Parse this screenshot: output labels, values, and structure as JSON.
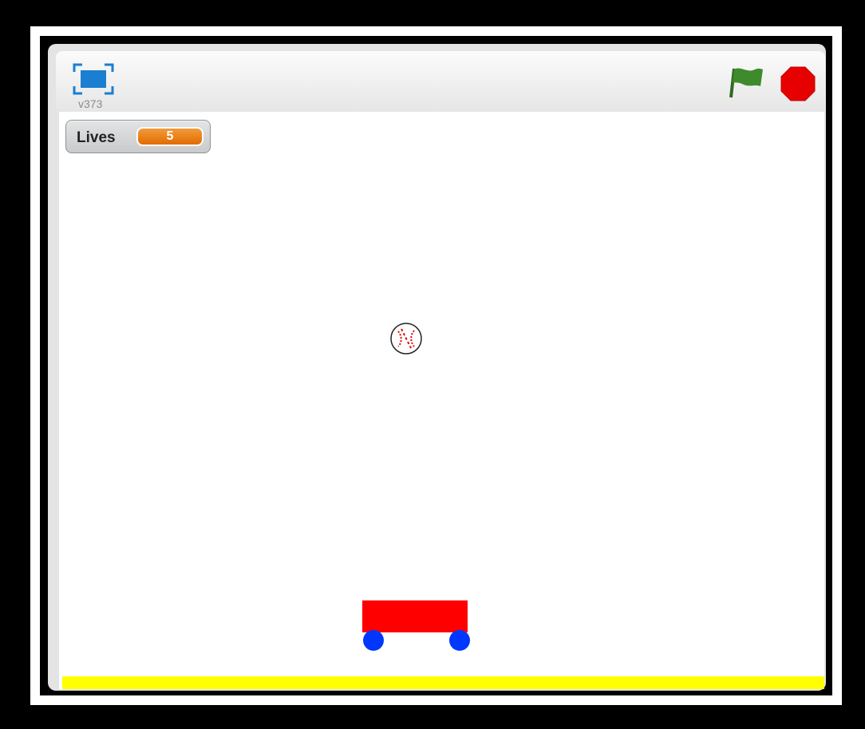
{
  "stage_header": {
    "version": "v373",
    "fullscreen_icon": "fullscreen-icon",
    "flag_icon": "green-flag-icon",
    "stop_icon": "stop-sign-icon"
  },
  "monitor": {
    "label": "Lives",
    "value": "5"
  },
  "colors": {
    "header_accent": "#1a7fd0",
    "flag": "#3f8a2c",
    "stop": "#e60000",
    "monitor_value_bg": "#e97a10",
    "cart_body": "#ff0000",
    "cart_wheels": "#0037ff",
    "ground": "#ffff00"
  },
  "sprites": [
    "baseball",
    "cart",
    "ground"
  ]
}
